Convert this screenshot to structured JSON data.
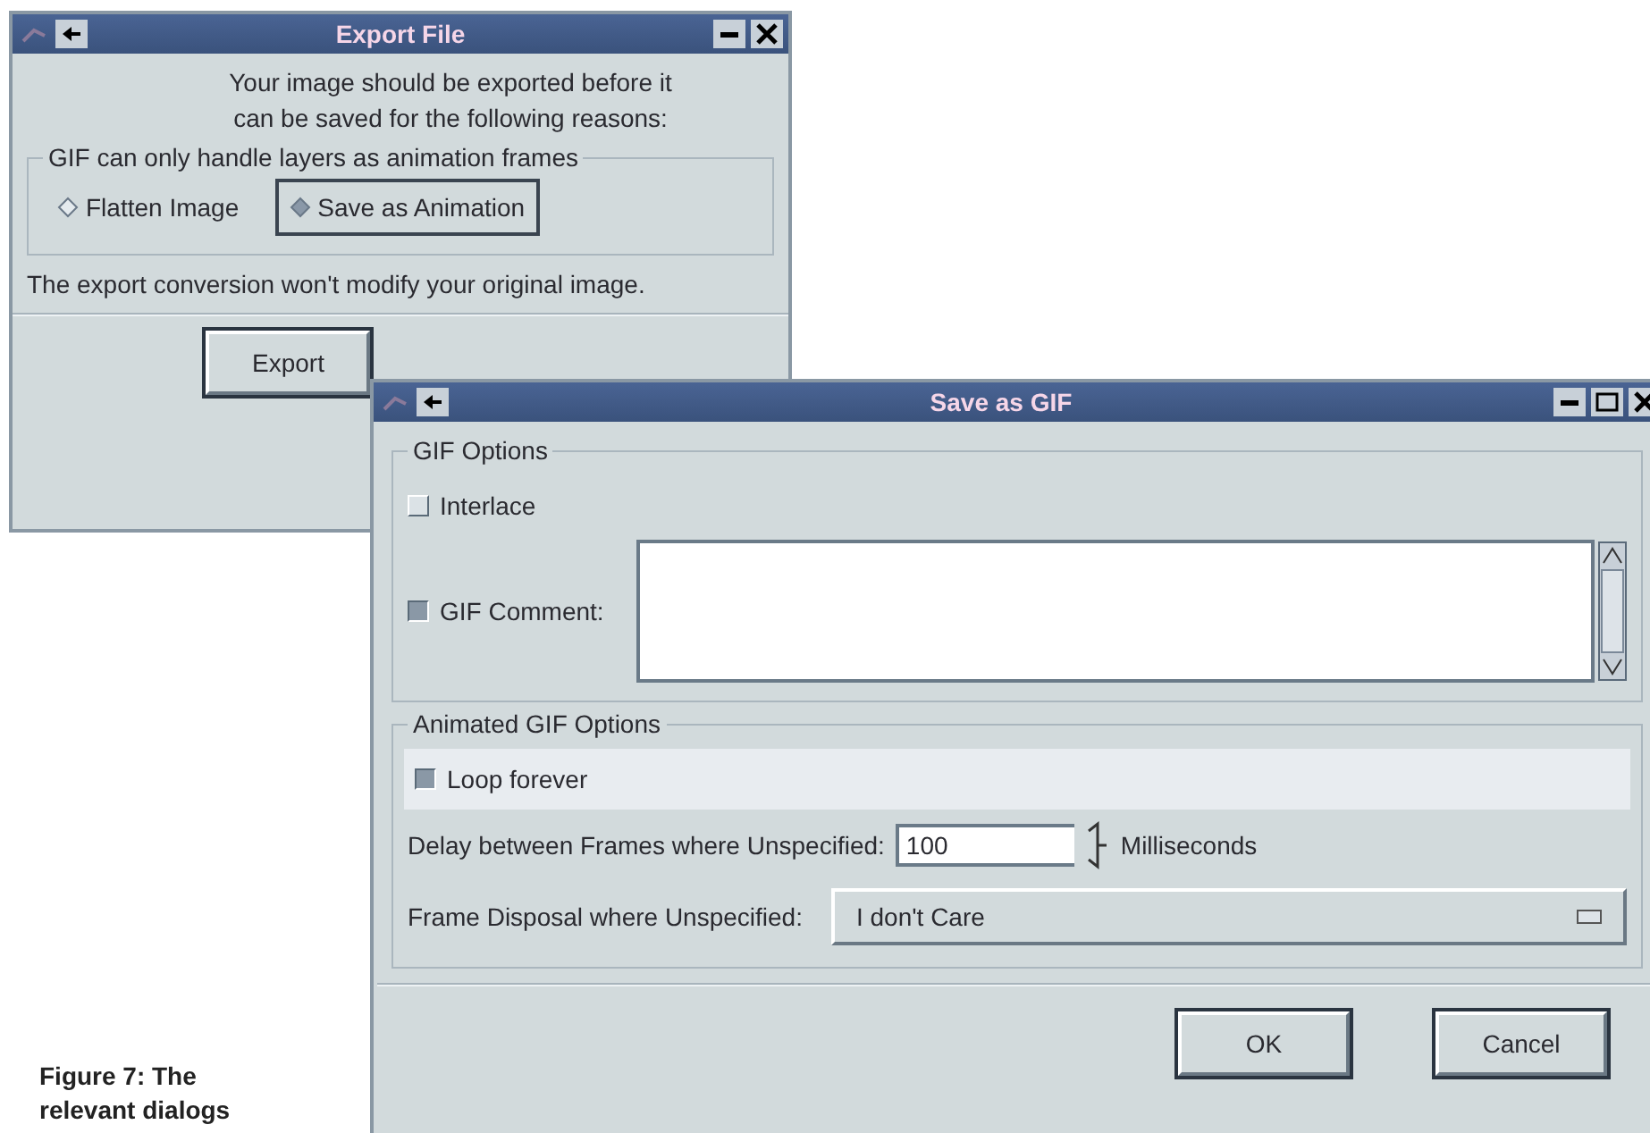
{
  "caption": [
    "Figure 7: The",
    "relevant dialogs"
  ],
  "export_window": {
    "title": "Export File",
    "message": [
      "Your image should be exported before it",
      "can be saved for the following reasons:"
    ],
    "group": {
      "label": "GIF can only handle layers as animation frames",
      "options": [
        {
          "label": "Flatten Image",
          "selected": false
        },
        {
          "label": "Save as Animation",
          "selected": true
        }
      ]
    },
    "note": "The export conversion won't modify your original image.",
    "buttons": [
      "Export"
    ]
  },
  "save_window": {
    "title": "Save as GIF",
    "gif_options": {
      "label": "GIF Options",
      "interlace": {
        "label": "Interlace",
        "checked": false
      },
      "comment": {
        "label": "GIF Comment:",
        "checked": true
      }
    },
    "animated_options": {
      "label": "Animated GIF Options",
      "loop": {
        "label": "Loop forever",
        "checked": true
      },
      "delay": {
        "label": "Delay between Frames where Unspecified:",
        "value": "100",
        "unit": "Milliseconds"
      },
      "disposal": {
        "label": "Frame Disposal where Unspecified:",
        "value": "I don't Care"
      }
    },
    "buttons": [
      "OK",
      "Cancel"
    ]
  }
}
